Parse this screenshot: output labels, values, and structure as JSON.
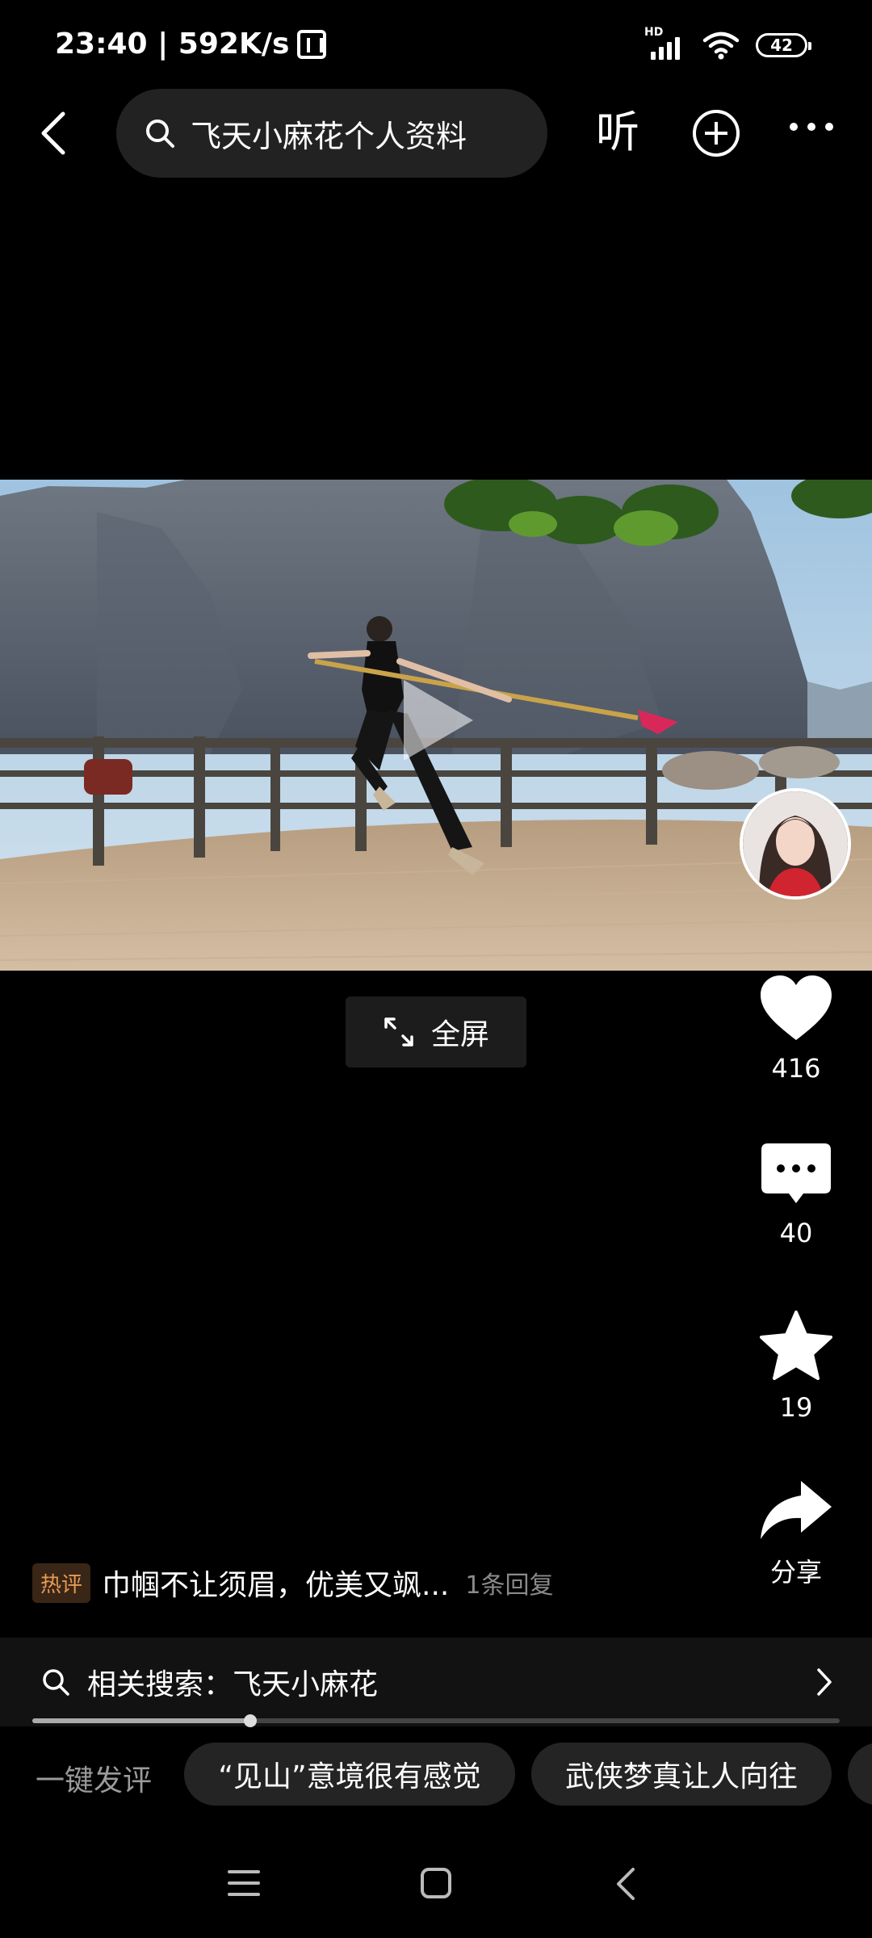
{
  "status_bar": {
    "time_speed": "23:40 | 592K/s",
    "hd_label": "HD",
    "battery": "42"
  },
  "nav": {
    "search_text": "飞天小麻花个人资料",
    "listen_label": "听"
  },
  "video": {
    "fullscreen_label": "全屏",
    "progress_fraction": 0.27
  },
  "actions": {
    "likes": "416",
    "comments": "40",
    "favorites": "19",
    "share_label": "分享"
  },
  "hot_comment": {
    "tag": "热评",
    "text": "巾帼不让须眉，优美又飒...",
    "replies": "1条回复"
  },
  "related_search": {
    "label": "相关搜索：飞天小麻花"
  },
  "quick_comments": {
    "label": "一键发评",
    "chips": [
      "“见山”意境很有感觉",
      "武侠梦真让人向往"
    ]
  },
  "colors": {
    "background": "#000000",
    "hot_tag": "#e79a55",
    "chip_bg": "#242424"
  }
}
